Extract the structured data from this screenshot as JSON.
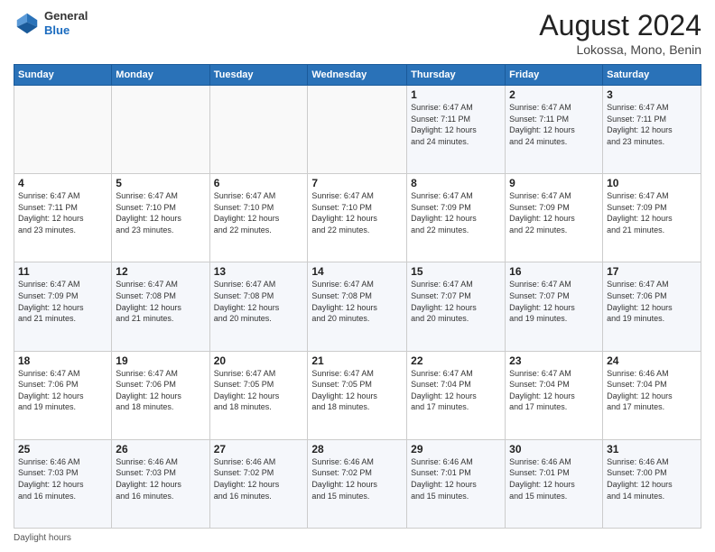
{
  "header": {
    "logo_general": "General",
    "logo_blue": "Blue",
    "month_year": "August 2024",
    "location": "Lokossa, Mono, Benin"
  },
  "days_of_week": [
    "Sunday",
    "Monday",
    "Tuesday",
    "Wednesday",
    "Thursday",
    "Friday",
    "Saturday"
  ],
  "weeks": [
    [
      {
        "day": "",
        "info": ""
      },
      {
        "day": "",
        "info": ""
      },
      {
        "day": "",
        "info": ""
      },
      {
        "day": "",
        "info": ""
      },
      {
        "day": "1",
        "info": "Sunrise: 6:47 AM\nSunset: 7:11 PM\nDaylight: 12 hours\nand 24 minutes."
      },
      {
        "day": "2",
        "info": "Sunrise: 6:47 AM\nSunset: 7:11 PM\nDaylight: 12 hours\nand 24 minutes."
      },
      {
        "day": "3",
        "info": "Sunrise: 6:47 AM\nSunset: 7:11 PM\nDaylight: 12 hours\nand 23 minutes."
      }
    ],
    [
      {
        "day": "4",
        "info": "Sunrise: 6:47 AM\nSunset: 7:11 PM\nDaylight: 12 hours\nand 23 minutes."
      },
      {
        "day": "5",
        "info": "Sunrise: 6:47 AM\nSunset: 7:10 PM\nDaylight: 12 hours\nand 23 minutes."
      },
      {
        "day": "6",
        "info": "Sunrise: 6:47 AM\nSunset: 7:10 PM\nDaylight: 12 hours\nand 22 minutes."
      },
      {
        "day": "7",
        "info": "Sunrise: 6:47 AM\nSunset: 7:10 PM\nDaylight: 12 hours\nand 22 minutes."
      },
      {
        "day": "8",
        "info": "Sunrise: 6:47 AM\nSunset: 7:09 PM\nDaylight: 12 hours\nand 22 minutes."
      },
      {
        "day": "9",
        "info": "Sunrise: 6:47 AM\nSunset: 7:09 PM\nDaylight: 12 hours\nand 22 minutes."
      },
      {
        "day": "10",
        "info": "Sunrise: 6:47 AM\nSunset: 7:09 PM\nDaylight: 12 hours\nand 21 minutes."
      }
    ],
    [
      {
        "day": "11",
        "info": "Sunrise: 6:47 AM\nSunset: 7:09 PM\nDaylight: 12 hours\nand 21 minutes."
      },
      {
        "day": "12",
        "info": "Sunrise: 6:47 AM\nSunset: 7:08 PM\nDaylight: 12 hours\nand 21 minutes."
      },
      {
        "day": "13",
        "info": "Sunrise: 6:47 AM\nSunset: 7:08 PM\nDaylight: 12 hours\nand 20 minutes."
      },
      {
        "day": "14",
        "info": "Sunrise: 6:47 AM\nSunset: 7:08 PM\nDaylight: 12 hours\nand 20 minutes."
      },
      {
        "day": "15",
        "info": "Sunrise: 6:47 AM\nSunset: 7:07 PM\nDaylight: 12 hours\nand 20 minutes."
      },
      {
        "day": "16",
        "info": "Sunrise: 6:47 AM\nSunset: 7:07 PM\nDaylight: 12 hours\nand 19 minutes."
      },
      {
        "day": "17",
        "info": "Sunrise: 6:47 AM\nSunset: 7:06 PM\nDaylight: 12 hours\nand 19 minutes."
      }
    ],
    [
      {
        "day": "18",
        "info": "Sunrise: 6:47 AM\nSunset: 7:06 PM\nDaylight: 12 hours\nand 19 minutes."
      },
      {
        "day": "19",
        "info": "Sunrise: 6:47 AM\nSunset: 7:06 PM\nDaylight: 12 hours\nand 18 minutes."
      },
      {
        "day": "20",
        "info": "Sunrise: 6:47 AM\nSunset: 7:05 PM\nDaylight: 12 hours\nand 18 minutes."
      },
      {
        "day": "21",
        "info": "Sunrise: 6:47 AM\nSunset: 7:05 PM\nDaylight: 12 hours\nand 18 minutes."
      },
      {
        "day": "22",
        "info": "Sunrise: 6:47 AM\nSunset: 7:04 PM\nDaylight: 12 hours\nand 17 minutes."
      },
      {
        "day": "23",
        "info": "Sunrise: 6:47 AM\nSunset: 7:04 PM\nDaylight: 12 hours\nand 17 minutes."
      },
      {
        "day": "24",
        "info": "Sunrise: 6:46 AM\nSunset: 7:04 PM\nDaylight: 12 hours\nand 17 minutes."
      }
    ],
    [
      {
        "day": "25",
        "info": "Sunrise: 6:46 AM\nSunset: 7:03 PM\nDaylight: 12 hours\nand 16 minutes."
      },
      {
        "day": "26",
        "info": "Sunrise: 6:46 AM\nSunset: 7:03 PM\nDaylight: 12 hours\nand 16 minutes."
      },
      {
        "day": "27",
        "info": "Sunrise: 6:46 AM\nSunset: 7:02 PM\nDaylight: 12 hours\nand 16 minutes."
      },
      {
        "day": "28",
        "info": "Sunrise: 6:46 AM\nSunset: 7:02 PM\nDaylight: 12 hours\nand 15 minutes."
      },
      {
        "day": "29",
        "info": "Sunrise: 6:46 AM\nSunset: 7:01 PM\nDaylight: 12 hours\nand 15 minutes."
      },
      {
        "day": "30",
        "info": "Sunrise: 6:46 AM\nSunset: 7:01 PM\nDaylight: 12 hours\nand 15 minutes."
      },
      {
        "day": "31",
        "info": "Sunrise: 6:46 AM\nSunset: 7:00 PM\nDaylight: 12 hours\nand 14 minutes."
      }
    ]
  ],
  "footer": {
    "daylight_hours_label": "Daylight hours"
  }
}
